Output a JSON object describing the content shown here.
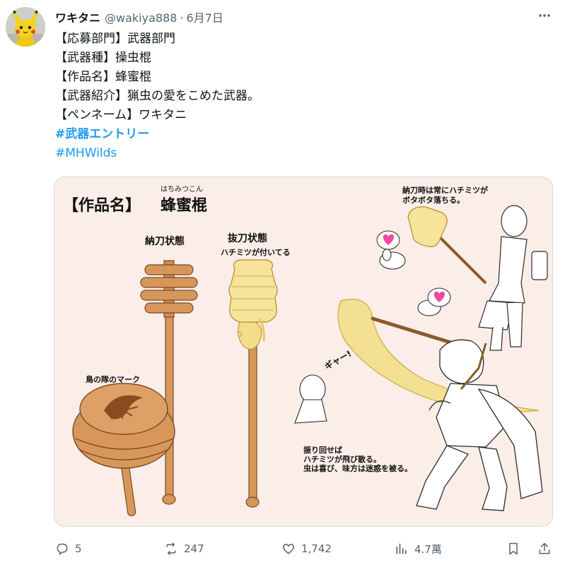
{
  "tweet": {
    "display_name": "ワキタニ",
    "handle": "@wakiya888",
    "separator": "·",
    "date": "6月7日",
    "lines": [
      "【応募部門】武器部門",
      "【武器種】操虫棍",
      "【作品名】蜂蜜棍",
      "【武器紹介】猟虫の愛をこめた武器。",
      "【ペンネーム】ワキタニ"
    ],
    "hashtags": [
      "#武器エントリー",
      "#MHWilds"
    ]
  },
  "artwork": {
    "title_label": "【作品名】",
    "title_ruby": "はちみつこん",
    "title": "蜂蜜棍",
    "sheathed_label": "納刀状態",
    "drawn_label": "抜刀状態",
    "drawn_sub": "ハチミツが付いてる",
    "mark_label": "鳥の隊のマーク",
    "note_top_1": "納刀時は常にハチミツが",
    "note_top_2": "ボタボタ落ちる。",
    "note_bottom_1": "振り回せば",
    "note_bottom_2": "ハチミツが飛び散る。",
    "note_bottom_3": "虫は喜び、味方は迷惑を被る。",
    "shout": "ギャー!",
    "colors": {
      "background": "#fbeee8",
      "wood": "#d8975a",
      "honey": "#f3dc8a"
    }
  },
  "actions": {
    "reply_count": "5",
    "repost_count": "247",
    "like_count": "1,742",
    "view_count": "4.7萬"
  },
  "icons": [
    "avatar-pikachu",
    "more-icon",
    "reply-icon",
    "repost-icon",
    "like-icon",
    "views-icon",
    "bookmark-icon",
    "share-icon"
  ],
  "colors": {
    "link": "#1d9bf0",
    "muted": "#536471",
    "text": "#0f1419",
    "border": "#cfd9de"
  }
}
